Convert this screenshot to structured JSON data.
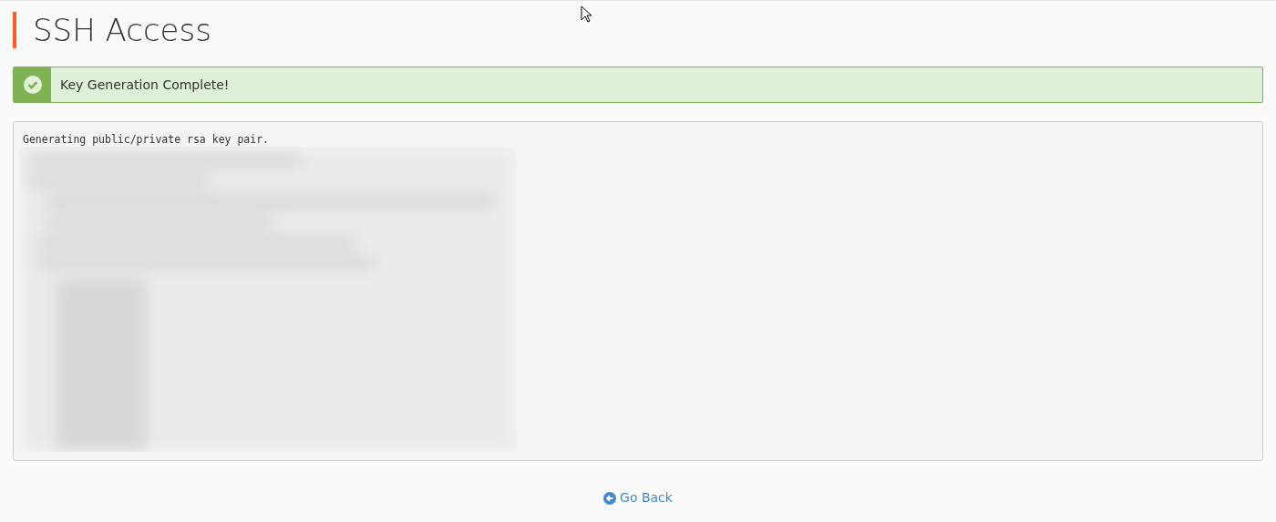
{
  "page": {
    "title": "SSH Access"
  },
  "alert": {
    "message": "Key Generation Complete!"
  },
  "output": {
    "lines": [
      "Generating public/private rsa key pair."
    ]
  },
  "go_back": {
    "label": "Go Back"
  }
}
